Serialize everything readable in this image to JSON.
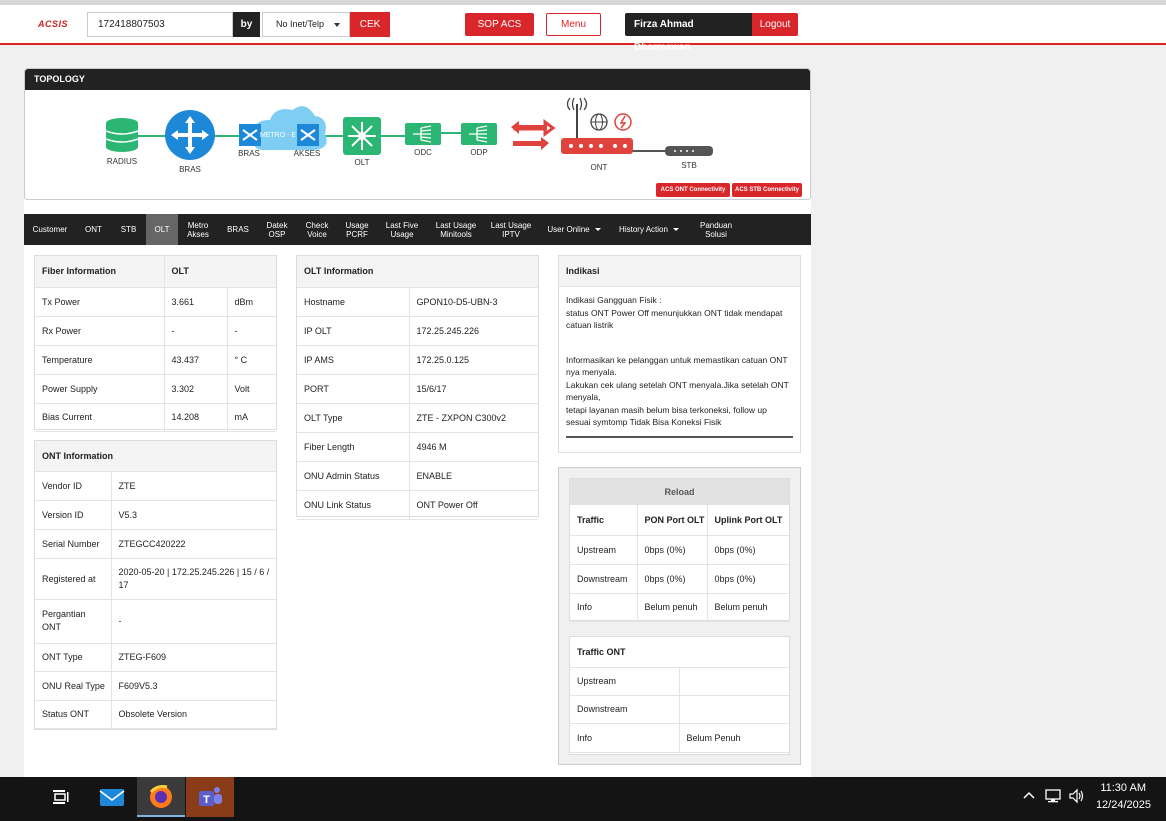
{
  "header": {
    "logo": "ACSIS",
    "search_value": "172418807503",
    "by_label": "by",
    "type_select": "No Inet/Telp",
    "cek_label": "CEK",
    "sop_label": "SOP ACS",
    "menu_label": "Menu",
    "user_name": "Firza Ahmad Dharmawan",
    "logout_label": "Logout",
    "accent_color": "#d9262a"
  },
  "topology": {
    "title": "TOPOLOGY",
    "nodes": {
      "radius": "RADIUS",
      "bras": "BRAS",
      "bras2": "BRAS",
      "metro": "METRO - E",
      "akses": "AKSES",
      "olt": "OLT",
      "odc": "ODC",
      "odp": "ODP",
      "ont": "ONT",
      "stb": "STB"
    },
    "acs_ont_btn": "ACS ONT Connectivity",
    "acs_stb_btn": "ACS STB Connectivity"
  },
  "tabs": [
    {
      "label": "Customer"
    },
    {
      "label": "ONT"
    },
    {
      "label": "STB"
    },
    {
      "label": "OLT"
    },
    {
      "label": "Metro Akses"
    },
    {
      "label": "BRAS"
    },
    {
      "label": "Datek OSP"
    },
    {
      "label": "Check Voice"
    },
    {
      "label": "Usage PCRF"
    },
    {
      "label": "Last Five Usage"
    },
    {
      "label": "Last Usage Minitools"
    },
    {
      "label": "Last Usage IPTV"
    },
    {
      "label": "User Online"
    },
    {
      "label": "History Action"
    },
    {
      "label": "Panduan Solusi"
    }
  ],
  "fiber": {
    "title": "Fiber Information",
    "col": "OLT",
    "rows": [
      {
        "label": "Tx Power",
        "value": "3.661",
        "unit": "dBm"
      },
      {
        "label": "Rx Power",
        "value": "-",
        "unit": "-"
      },
      {
        "label": "Temperature",
        "value": "43.437",
        "unit": "° C"
      },
      {
        "label": "Power Supply",
        "value": "3.302",
        "unit": "Volt"
      },
      {
        "label": "Bias Current",
        "value": "14.208",
        "unit": "mA"
      }
    ]
  },
  "ont_info": {
    "title": "ONT Information",
    "rows": [
      {
        "label": "Vendor ID",
        "value": "ZTE"
      },
      {
        "label": "Version ID",
        "value": "V5.3"
      },
      {
        "label": "Serial Number",
        "value": "ZTEGCC420222"
      },
      {
        "label": "Registered at",
        "value": "2020-05-20 | 172.25.245.226 | 15 / 6 / 17"
      },
      {
        "label": "Pergantian ONT",
        "value": "-"
      },
      {
        "label": "ONT Type",
        "value": "ZTEG-F609"
      },
      {
        "label": "ONU Real Type",
        "value": "F609V5.3"
      },
      {
        "label": "Status ONT",
        "value": "Obsolete Version"
      }
    ]
  },
  "olt_info": {
    "title": "OLT Information",
    "rows": [
      {
        "label": "Hostname",
        "value": "GPON10-D5-UBN-3"
      },
      {
        "label": "IP OLT",
        "value": "172.25.245.226"
      },
      {
        "label": "IP AMS",
        "value": "172.25.0.125"
      },
      {
        "label": "PORT",
        "value": "15/6/17"
      },
      {
        "label": "OLT Type",
        "value": "ZTE - ZXPON C300v2"
      },
      {
        "label": "Fiber Length",
        "value": "4946 M"
      },
      {
        "label": "ONU Admin Status",
        "value": "ENABLE"
      },
      {
        "label": "ONU Link Status",
        "value": "ONT Power Off"
      }
    ]
  },
  "indikasi": {
    "title": "Indikasi",
    "p1": "Indikasi Gangguan Fisik :",
    "p2": "status ONT Power Off menunjukkan ONT tidak mendapat catuan listrik",
    "p3": "Informasikan ke pelanggan untuk memastikan catuan ONT nya menyala.",
    "p4": "Lakukan cek ulang setelah ONT menyala.Jika setelah ONT menyala,",
    "p5": "tetapi layanan masih belum bisa terkoneksi, follow up sesuai symtomp Tidak Bisa Koneksi Fisik"
  },
  "traffic": {
    "reload_label": "Reload",
    "headers": [
      "Traffic",
      "PON Port OLT",
      "Uplink Port OLT"
    ],
    "rows": [
      {
        "label": "Upstream",
        "pon": "0bps (0%)",
        "uplink": "0bps (0%)"
      },
      {
        "label": "Downstream",
        "pon": "0bps (0%)",
        "uplink": "0bps (0%)"
      },
      {
        "label": "Info",
        "pon": "Belum penuh",
        "uplink": "Belum penuh"
      }
    ]
  },
  "traffic_ont": {
    "title": "Traffic ONT",
    "rows": [
      {
        "label": "Upstream",
        "value": ""
      },
      {
        "label": "Downstream",
        "value": ""
      },
      {
        "label": "Info",
        "value": "Belum Penuh"
      }
    ]
  },
  "taskbar": {
    "time": "11:30 AM",
    "date": "12/24/2025"
  }
}
